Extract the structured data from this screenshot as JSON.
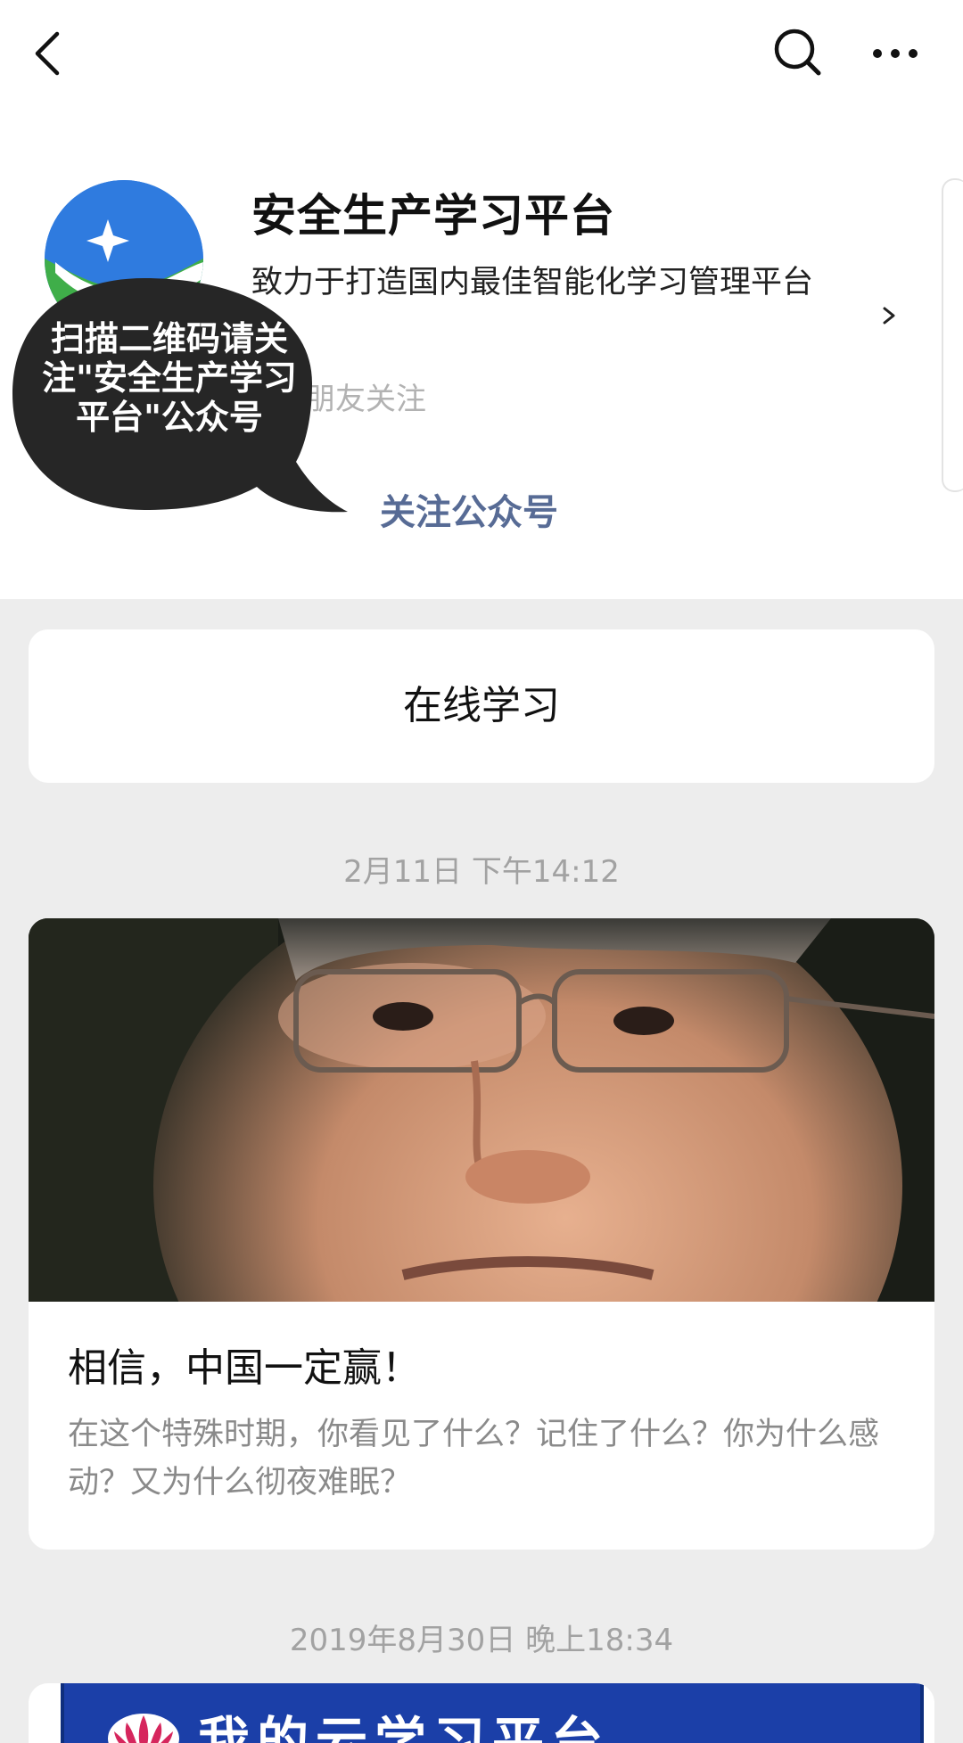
{
  "topbar": {
    "back_icon": "chevron-left-icon",
    "search_icon": "search-icon",
    "more_icon": "more-horizontal-icon"
  },
  "profile": {
    "name": "安全生产学习平台",
    "description": "致力于打造国内最佳智能化学习管理平台",
    "friends_text": "朋友关注",
    "follow_label": "关注公众号",
    "avatar_colors": {
      "blue": "#2f7bdf",
      "green": "#3fae49"
    }
  },
  "overlay": {
    "bubble_text": "扫描二维码请关注\"安全生产学习平台\"公众号",
    "bubble_color": "#262626"
  },
  "menu": {
    "label": "在线学习"
  },
  "articles": [
    {
      "timestamp": "2月11日 下午14:12",
      "title": "相信，中国一定赢！",
      "digest": "在这个特殊时期，你看见了什么？记住了什么？你为什么感动？又为什么彻夜难眠？"
    },
    {
      "timestamp": "2019年8月30日 晚上18:34",
      "image_text": "我的云学习平台"
    }
  ],
  "colors": {
    "link": "#576b95",
    "page_bg": "#ededed",
    "muted": "#a2a2a2"
  }
}
